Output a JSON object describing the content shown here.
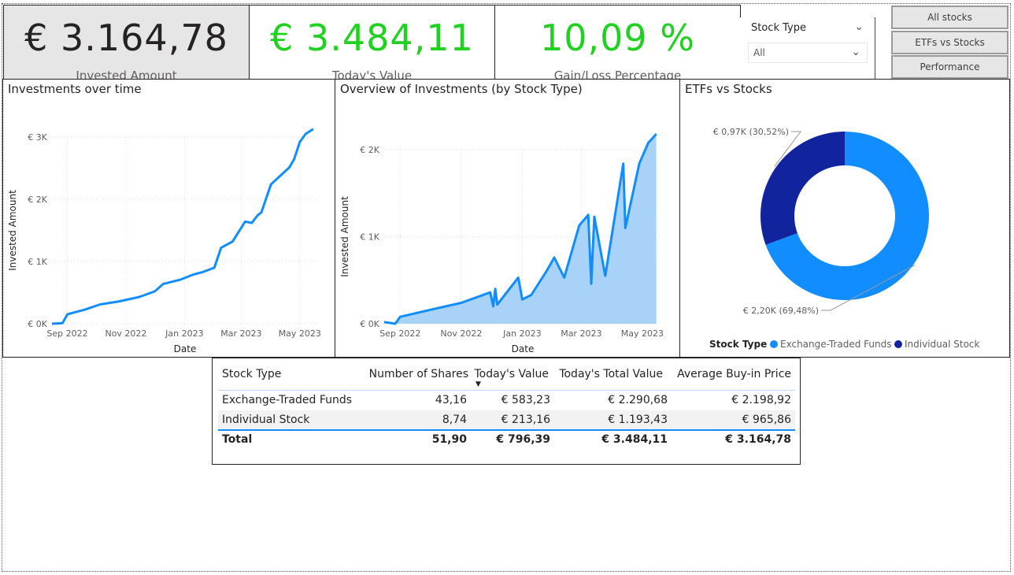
{
  "kpis": {
    "invested": {
      "value": "€ 3.164,78",
      "label": "Invested Amount"
    },
    "today": {
      "value": "€ 3.484,11",
      "label": "Today's Value"
    },
    "gain": {
      "value": "10,09 %",
      "label": "Gain/Loss Percentage"
    }
  },
  "colors": {
    "gain_green": "#1fd21f",
    "etf_blue": "#118dff",
    "stock_navy": "#12239e",
    "area_fill": "#a8d2f8"
  },
  "slicer": {
    "title": "Stock Type",
    "selected": "All"
  },
  "nav": {
    "all_stocks": "All stocks",
    "etfs_vs_stocks": "ETFs vs Stocks",
    "performance": "Performance"
  },
  "charts": {
    "over_time": {
      "title": "Investments over time"
    },
    "by_type": {
      "title": "Overview of Investments (by Stock Type)"
    },
    "donut": {
      "title": "ETFs vs Stocks"
    }
  },
  "chart_data": [
    {
      "type": "line",
      "title": "Investments over time",
      "xlabel": "Date",
      "ylabel": "Invested Amount",
      "x_ticks": [
        "Sep 2022",
        "Nov 2022",
        "Jan 2023",
        "Mar 2023",
        "May 2023"
      ],
      "y_ticks": [
        "€ 0K",
        "€ 1K",
        "€ 2K",
        "€ 3K"
      ],
      "ylim": [
        0,
        3000
      ],
      "grid": true,
      "series": [
        {
          "x": [
            "2022-08-16",
            "2022-08-27",
            "2022-09-01",
            "2022-09-20",
            "2022-10-05",
            "2022-10-25",
            "2022-11-15",
            "2022-12-01",
            "2022-12-10",
            "2022-12-28",
            "2023-01-10",
            "2023-01-20",
            "2023-02-01",
            "2023-02-08",
            "2023-02-20",
            "2023-03-05",
            "2023-03-12",
            "2023-03-18",
            "2023-03-22",
            "2023-04-01",
            "2023-04-20",
            "2023-04-25",
            "2023-05-01",
            "2023-05-07",
            "2023-05-15"
          ],
          "y": [
            0,
            10,
            150,
            230,
            310,
            360,
            430,
            520,
            640,
            710,
            790,
            830,
            900,
            1220,
            1320,
            1640,
            1620,
            1740,
            1790,
            2240,
            2510,
            2640,
            2920,
            3050,
            3130
          ]
        }
      ]
    },
    {
      "type": "area",
      "title": "Overview of Investments (by Stock Type)",
      "xlabel": "Date",
      "ylabel": "Invested Amount",
      "x_ticks": [
        "Sep 2022",
        "Nov 2022",
        "Jan 2023",
        "Mar 2023",
        "May 2023"
      ],
      "y_ticks": [
        "€ 0K",
        "€ 1K",
        "€ 2K"
      ],
      "ylim": [
        0,
        2000
      ],
      "grid": true,
      "series": [
        {
          "x": [
            "2022-08-16",
            "2022-08-27",
            "2022-09-01",
            "2022-09-20",
            "2022-10-05",
            "2022-11-01",
            "2022-11-30",
            "2022-12-03",
            "2022-12-05",
            "2022-12-07",
            "2022-12-28",
            "2023-01-01",
            "2023-01-10",
            "2023-01-25",
            "2023-02-02",
            "2023-02-12",
            "2023-02-27",
            "2023-03-08",
            "2023-03-11",
            "2023-03-14",
            "2023-03-25",
            "2023-04-12",
            "2023-04-14",
            "2023-04-28",
            "2023-05-07",
            "2023-05-15"
          ],
          "y": [
            20,
            0,
            80,
            130,
            170,
            240,
            360,
            200,
            400,
            220,
            530,
            280,
            330,
            600,
            760,
            530,
            1130,
            1250,
            460,
            1230,
            550,
            1840,
            1100,
            1840,
            2080,
            2180
          ]
        }
      ]
    },
    {
      "type": "pie",
      "title": "ETFs vs Stocks",
      "legend_title": "Stock Type",
      "legend_placement": "bottom",
      "labels": [
        "Exchange-Traded Funds",
        "Individual Stock"
      ],
      "values": [
        2200,
        970
      ],
      "percent": [
        69.48,
        30.52
      ],
      "data_labels": [
        "€ 2,20K (69,48%)",
        "€ 0,97K (30,52%)"
      ],
      "colors": [
        "#118dff",
        "#12239e"
      ]
    }
  ],
  "table": {
    "columns": [
      "Stock Type",
      "Number of Shares",
      "Today's Value",
      "Today's Total Value",
      "Average Buy-in Price"
    ],
    "sort_indicator": "▼",
    "rows": [
      [
        "Exchange-Traded Funds",
        "43,16",
        "€ 583,23",
        "€ 2.290,68",
        "€ 2.198,92"
      ],
      [
        "Individual Stock",
        "8,74",
        "€ 213,16",
        "€ 1.193,43",
        "€ 965,86"
      ]
    ],
    "total": [
      "Total",
      "51,90",
      "€ 796,39",
      "€ 3.484,11",
      "€ 3.164,78"
    ]
  }
}
